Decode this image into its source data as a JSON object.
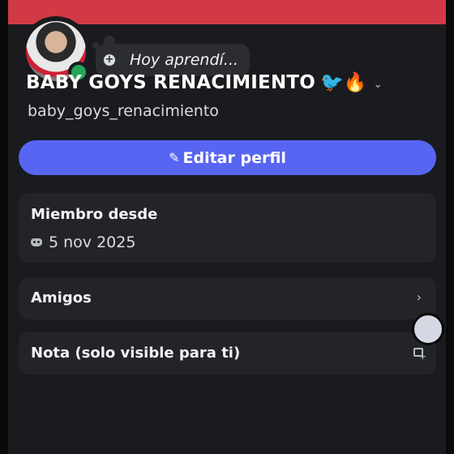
{
  "profile": {
    "custom_status": "Hoy aprendí...",
    "display_name": "BABY GOYS RENACIMIENTO",
    "name_emoji": "🐦🔥",
    "username": "baby_goys_renacimiento",
    "status": "online"
  },
  "actions": {
    "edit_profile_label": "Editar perfil"
  },
  "member_since": {
    "title": "Miembro desde",
    "date": "5 nov 2025"
  },
  "rows": {
    "friends_label": "Amigos",
    "note_label": "Nota (solo visible para ti)"
  },
  "colors": {
    "banner": "#d13a44",
    "accent": "#5865f2",
    "online": "#23a55a"
  },
  "icons": {
    "add_status": "plus-circle-icon",
    "edit": "pencil-icon",
    "discord": "discord-icon",
    "chevron": "chevron-right-icon",
    "note": "note-add-icon"
  }
}
